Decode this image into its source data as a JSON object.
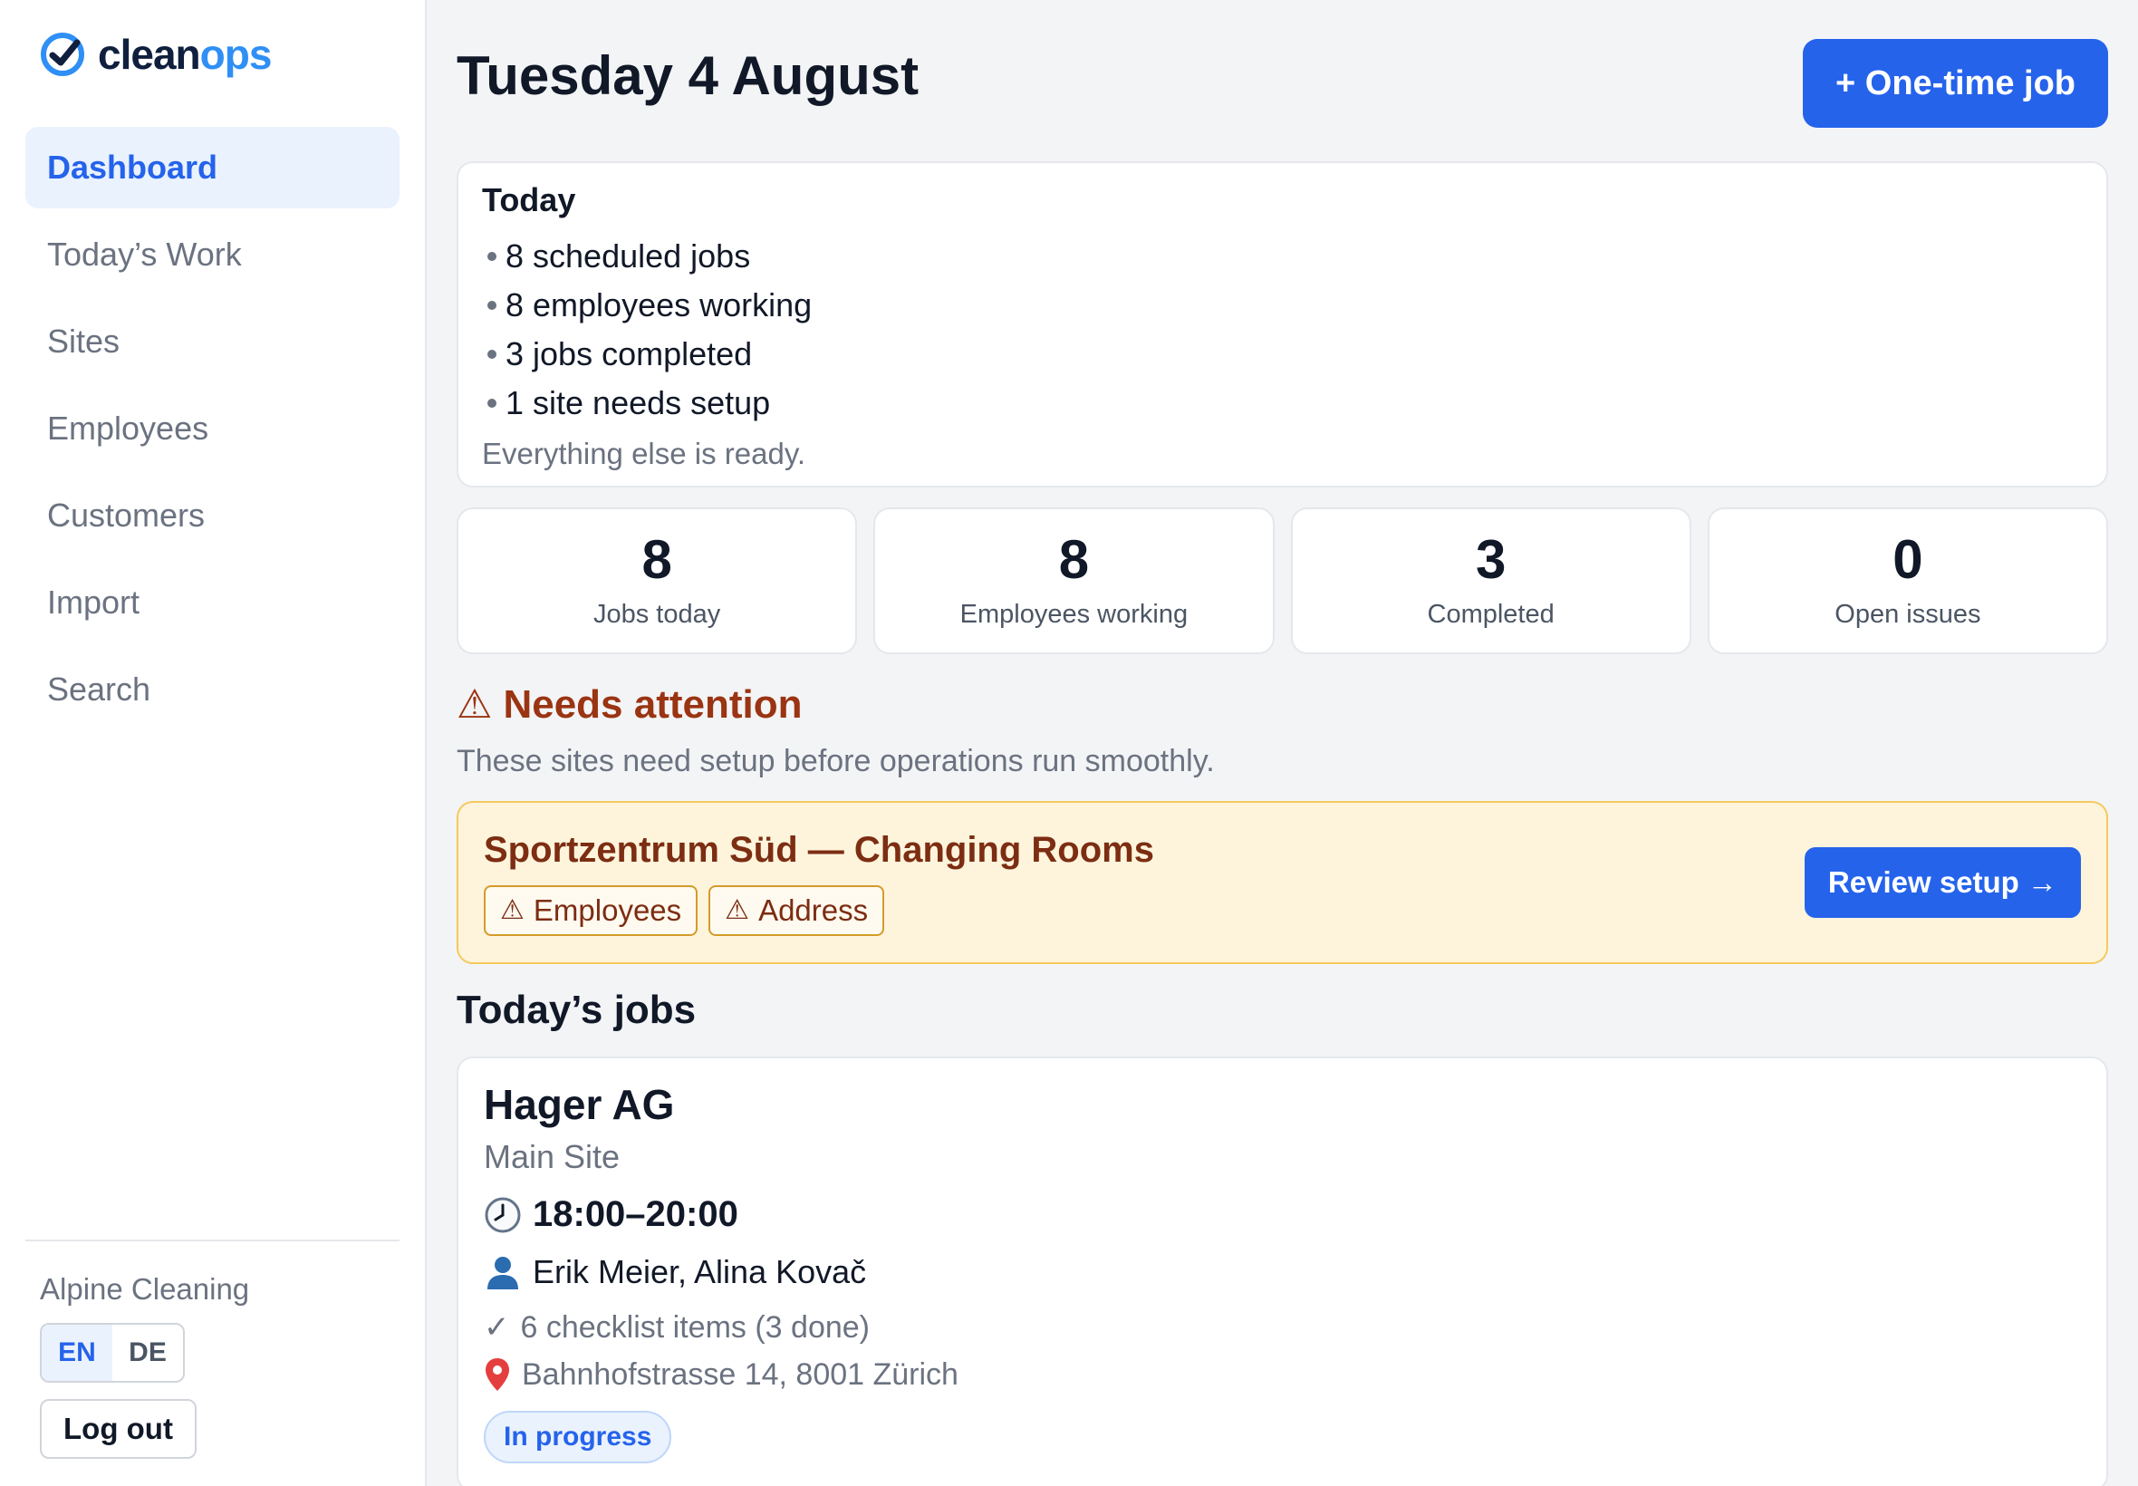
{
  "brand": {
    "name_part1": "clean",
    "name_part2": "ops"
  },
  "sidebar": {
    "items": [
      {
        "label": "Dashboard"
      },
      {
        "label": "Today’s Work"
      },
      {
        "label": "Sites"
      },
      {
        "label": "Employees"
      },
      {
        "label": "Customers"
      },
      {
        "label": "Import"
      },
      {
        "label": "Search"
      }
    ],
    "active_index": 0,
    "org_name": "Alpine Cleaning",
    "lang": [
      "EN",
      "DE"
    ],
    "lang_selected": "EN",
    "logout_label": "Log out"
  },
  "header": {
    "title": "Tuesday 4 August",
    "one_time_job_label": "+ One-time job"
  },
  "today": {
    "title": "Today",
    "items": [
      "8 scheduled jobs",
      "8 employees working",
      "3 jobs completed",
      "1 site needs setup"
    ],
    "note": "Everything else is ready."
  },
  "stats": [
    {
      "value": "8",
      "label": "Jobs today"
    },
    {
      "value": "8",
      "label": "Employees working"
    },
    {
      "value": "3",
      "label": "Completed"
    },
    {
      "value": "0",
      "label": "Open issues"
    }
  ],
  "attention": {
    "icon": "⚠",
    "title": "Needs attention",
    "subtitle": "These sites need setup before operations run smoothly.",
    "site": "Sportzentrum Süd — Changing Rooms",
    "tags": [
      "Employees",
      "Address"
    ],
    "review_label": "Review setup →"
  },
  "jobs": {
    "section_title": "Today’s jobs",
    "items": [
      {
        "customer": "Hager AG",
        "site": "Main Site",
        "time": "18:00–20:00",
        "people": "Erik Meier, Alina Kovač",
        "checklist": "6 checklist items (3 done)",
        "address": "Bahnhofstrasse 14, 8001 Zürich",
        "status": "In progress"
      }
    ]
  },
  "colors": {
    "accent": "#2563eb",
    "brand_accent": "#2f8ff5",
    "warning_text": "#9a3412",
    "warning_bg": "#fef4dc"
  }
}
